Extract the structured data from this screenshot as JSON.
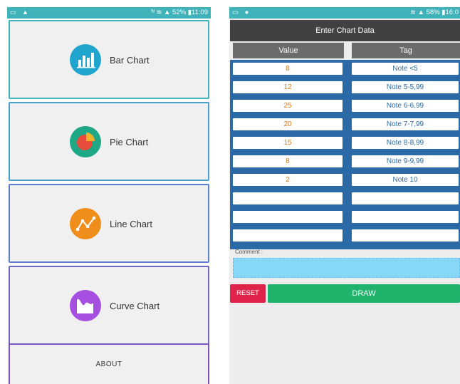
{
  "left_screen": {
    "status": {
      "icons_left": "▭ ▲",
      "right_text": "ᴺ ≋ ▲ 52% ▮11:09"
    },
    "menu": [
      {
        "label": "Bar Chart",
        "icon": "bar-chart-icon",
        "icon_color": "#20a5cf",
        "border_color": "#3fb2ba"
      },
      {
        "label": "Pie Chart",
        "icon": "pie-chart-icon",
        "icon_color": "#1fa886",
        "border_color": "#4b9fd0"
      },
      {
        "label": "Line Chart",
        "icon": "line-chart-icon",
        "icon_color": "#ef8e1b",
        "border_color": "#5d7fcc"
      },
      {
        "label": "Curve Chart",
        "icon": "curve-chart-icon",
        "icon_color": "#a64fe0",
        "border_color": "#6f66c6"
      }
    ],
    "about_label": "ABOUT"
  },
  "right_screen": {
    "status": {
      "icons_left": "▭ ●",
      "right_text": "≋ ▲ 58% ▮16:0"
    },
    "title": "Enter Chart Data",
    "columns": {
      "value": "Value",
      "tag": "Tag"
    },
    "rows": [
      {
        "value": "8",
        "tag": "Note <5"
      },
      {
        "value": "12",
        "tag": "Note 5-5,99"
      },
      {
        "value": "25",
        "tag": "Note 6-6,99"
      },
      {
        "value": "20",
        "tag": "Note 7-7,99"
      },
      {
        "value": "15",
        "tag": "Note 8-8,99"
      },
      {
        "value": "8",
        "tag": "Note 9-9,99"
      },
      {
        "value": "2",
        "tag": "Note 10"
      },
      {
        "value": "",
        "tag": ""
      },
      {
        "value": "",
        "tag": ""
      },
      {
        "value": "",
        "tag": ""
      }
    ],
    "comment_label": "Comment :",
    "comment_value": "",
    "reset_label": "RESET",
    "draw_label": "DRAW",
    "colors": {
      "value_text": "#e37a19",
      "tag_text": "#2b6aa6",
      "reset": "#e0234a",
      "draw": "#1fb36c"
    }
  }
}
